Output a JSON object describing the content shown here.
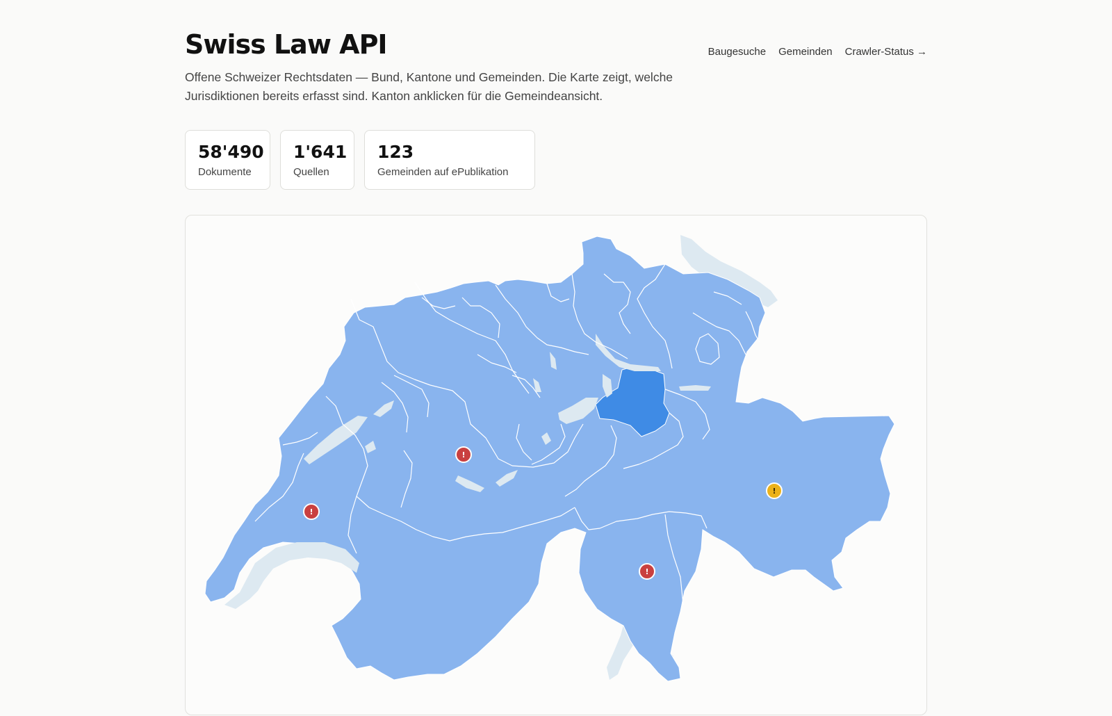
{
  "header": {
    "title": "Swiss Law API",
    "subtitle": "Offene Schweizer Rechtsdaten — Bund, Kantone und Gemeinden. Die Karte zeigt, welche Jurisdiktionen bereits erfasst sind. Kanton anklicken für die Gemeindeansicht."
  },
  "nav": [
    {
      "label": "Baugesuche"
    },
    {
      "label": "Gemeinden"
    },
    {
      "label": "Crawler-Status →"
    }
  ],
  "stats": [
    {
      "value": "58'490",
      "label": "Dokumente"
    },
    {
      "value": "1'641",
      "label": "Quellen"
    },
    {
      "value": "123",
      "label": "Gemeinden auf ePublikation"
    }
  ],
  "map": {
    "colors": {
      "covered": "#89b4ee",
      "selected": "#3f8be5",
      "lake": "#dde9f1",
      "border": "#ffffff",
      "marker_error": "#c94040",
      "marker_warning": "#ecb21b"
    },
    "selected_canton": "Schwyz",
    "markers": [
      {
        "symbol": "!",
        "status": "error"
      },
      {
        "symbol": "!",
        "status": "error"
      },
      {
        "symbol": "!",
        "status": "error"
      },
      {
        "symbol": "!",
        "status": "warning"
      }
    ]
  }
}
